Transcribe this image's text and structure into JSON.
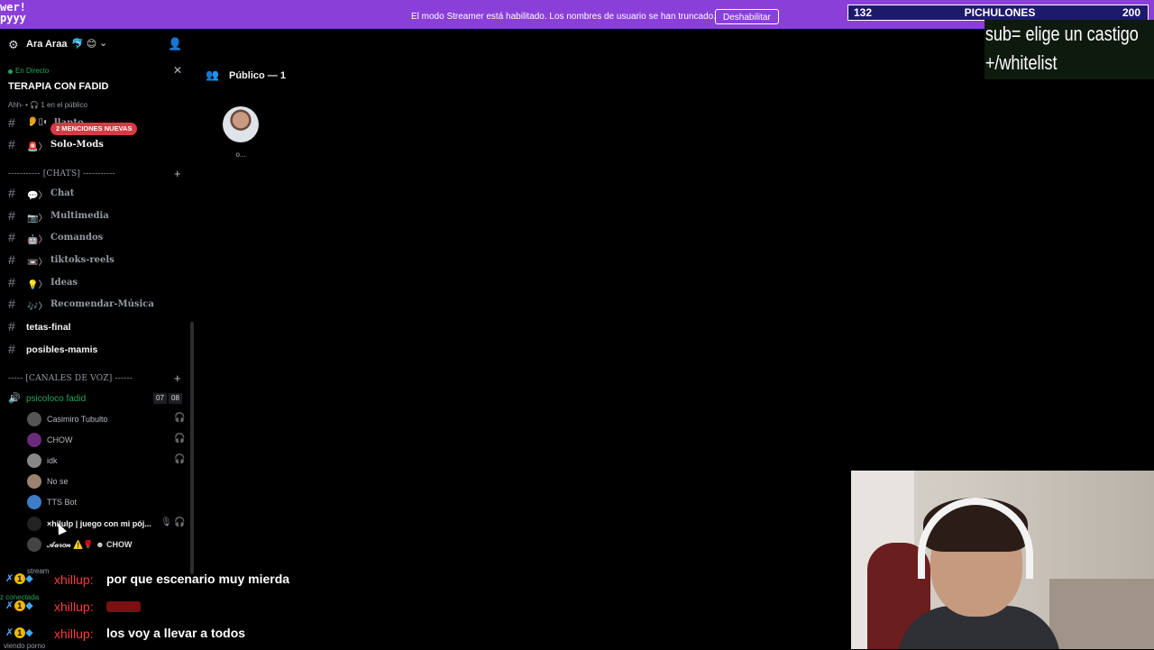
{
  "banner": {
    "logo_line1": "wer!",
    "logo_line2": "pyyy",
    "message": "El modo Streamer está habilitado. Los nombres de usuario se han truncado.",
    "button": "Deshabilitar",
    "color": "#8b3fd9"
  },
  "counter": {
    "left": "132",
    "label": "PICHULONES",
    "right": "200"
  },
  "server": {
    "name": "Ara Araa",
    "badges": "🐬 😊",
    "icon": "gear-icon",
    "invite_icon": "add-member-icon"
  },
  "live": {
    "label": "En Directo",
    "title": "TERAPIA CON FADID",
    "subtitle": "Ahh- • 🎧 1 en el público"
  },
  "mentions": "2 MENCIONES NUEVAS",
  "channels_top": [
    {
      "emoji": "👂▯◐",
      "name": "llanto",
      "style": "dim"
    },
    {
      "emoji": "🚨〉",
      "name": "Solo-Mods",
      "style": "bright"
    }
  ],
  "category_chats": "----------- [CHATS] -----------",
  "channels_chats": [
    {
      "emoji": "💬〉",
      "name": "Chat"
    },
    {
      "emoji": "📷〉",
      "name": "Multimedia"
    },
    {
      "emoji": "🤖〉",
      "name": "Comandos"
    },
    {
      "emoji": "📼〉",
      "name": "tiktoks-reels"
    },
    {
      "emoji": "💡〉",
      "name": "Ideas"
    },
    {
      "emoji": "🎶〉",
      "name": "Recomendar-Música"
    }
  ],
  "channels_plain": [
    {
      "name": "tetas-final"
    },
    {
      "name": "posibles-mamis"
    }
  ],
  "category_voice": "----- [CANALES DE VOZ] ------",
  "voice_channel": {
    "name": "psicoloco fadid",
    "count_a": "07",
    "count_b": "08"
  },
  "voice_users": [
    {
      "name": "Casimiro Tubulto",
      "muted": true
    },
    {
      "name": "CHOW",
      "muted": true
    },
    {
      "name": "idk",
      "muted": true
    },
    {
      "name": "No se",
      "muted": false
    },
    {
      "name": "TTS Bot",
      "muted": false
    },
    {
      "name": "×hilulp | juego con mi pój...",
      "muted": true
    },
    {
      "name": "𝒜𝒶𝓇𝑜𝓃 ⚠️🌹 ☻ CHOW",
      "muted": false
    }
  ],
  "stage": {
    "audience_label": "Público — 1",
    "audience_member": "o..."
  },
  "overlay": {
    "line1": "sub= elige un castigo",
    "line2": "+/whitelist"
  },
  "chat": [
    {
      "user": "xhillup:",
      "text": "por que escenario muy mierda"
    },
    {
      "user": "xhillup:",
      "text": ""
    },
    {
      "user": "xhillup:",
      "text": "los voy a llevar a todos"
    }
  ],
  "chat_side": {
    "stream": "stream",
    "connected": "z conectada",
    "viewing": "viendo porno"
  }
}
